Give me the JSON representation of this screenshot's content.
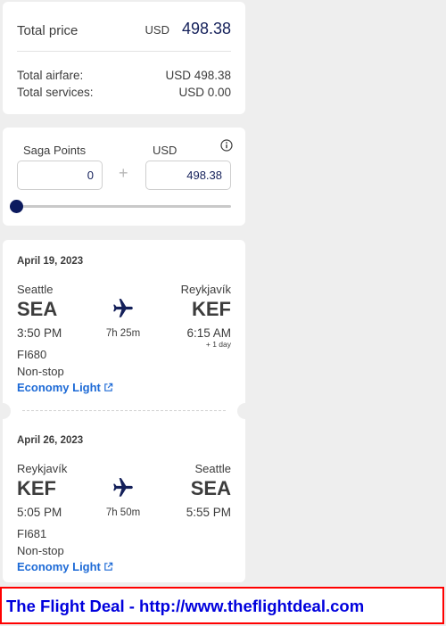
{
  "price": {
    "total_label": "Total price",
    "currency": "USD",
    "total_amount": "498.38",
    "airfare_label": "Total airfare:",
    "airfare_value": "USD 498.38",
    "services_label": "Total services:",
    "services_value": "USD 0.00"
  },
  "saga": {
    "points_label": "Saga Points",
    "usd_label": "USD",
    "points_value": "0",
    "usd_value": "498.38",
    "plus": "+",
    "slider_fraction": 0
  },
  "flights": [
    {
      "date": "April 19, 2023",
      "from_city": "Seattle",
      "from_code": "SEA",
      "to_city": "Reykjavík",
      "to_code": "KEF",
      "depart_time": "3:50 PM",
      "duration": "7h 25m",
      "arrive_time": "6:15 AM",
      "day_offset": "+ 1 day",
      "flight_number": "FI680",
      "stops": "Non-stop",
      "fare": "Economy Light"
    },
    {
      "date": "April 26, 2023",
      "from_city": "Reykjavík",
      "from_code": "KEF",
      "to_city": "Seattle",
      "to_code": "SEA",
      "depart_time": "5:05 PM",
      "duration": "7h 50m",
      "arrive_time": "5:55 PM",
      "flight_number": "FI681",
      "stops": "Non-stop",
      "fare": "Economy Light"
    }
  ],
  "banner": {
    "text": "The Flight Deal - http://www.theflightdeal.com"
  },
  "icons": {
    "info": "info-icon",
    "plane": "airplane-icon",
    "external": "external-link-icon"
  },
  "colors": {
    "navy": "#14205a",
    "link": "#1d6ad6",
    "banner_border": "#ff0000",
    "banner_text": "#0000dd"
  }
}
